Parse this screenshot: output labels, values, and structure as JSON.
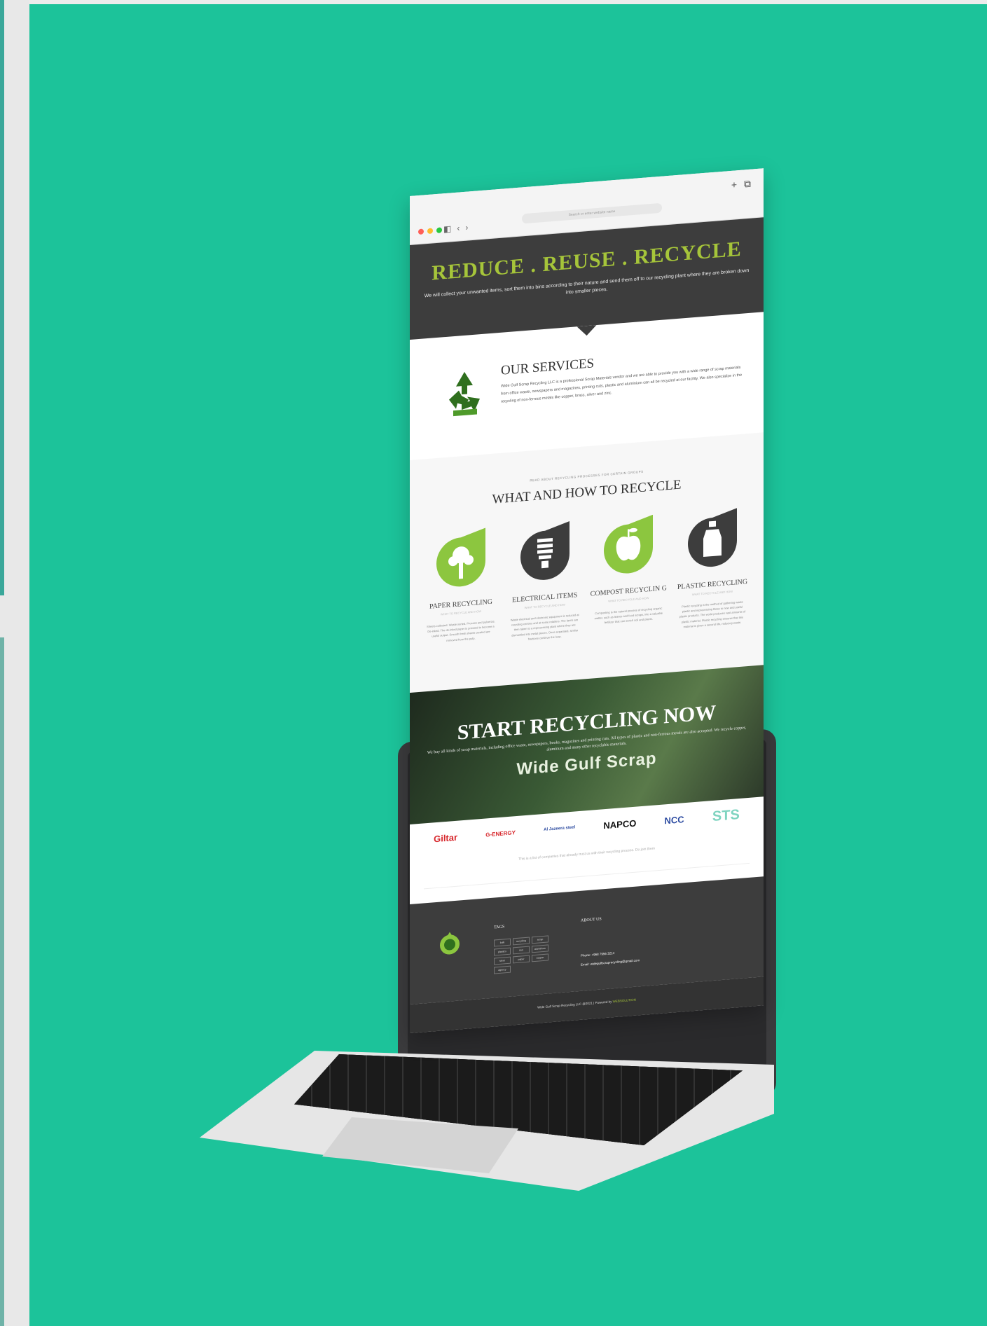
{
  "browser": {
    "url": "Search or enter website name",
    "nav_back": "‹",
    "nav_forward": "›",
    "sidebar_icon": "◧",
    "new_tab_icon": "+",
    "tabs_icon": "⧉"
  },
  "hero": {
    "title": "REDUCE . REUSE . RECYCLE",
    "text": "We will collect your unwanted items, sort them into bins according to their nature and send them off to our recycling plant where they are broken down into smaller pieces."
  },
  "services": {
    "title": "OUR SERVICES",
    "text": "Wide Gulf Scrap Recycling LLC is a professional Scrap Materials vendor and we are able to provide you with a wide range of scrap materials from office waste, newspapers and magazines, printing cuts, plastic and aluminium can all be recycled at our facility. We also specialize in the recycling of non-ferrous metals like copper, brass, silver and zinc."
  },
  "recycle": {
    "kicker": "READ ABOUT RECYCLING PROCESSES FOR CERTAIN GROUPS",
    "title": "WHAT AND HOW TO RECYCLE",
    "cards": [
      {
        "title": "PAPER RECYCLING",
        "sub": "WHAT TO RECYCLE AND HOW",
        "desc": "Sheets collected. Waste sorted. Process and pulverize. De-inked. The de-inked paper is pressed to become a useful output. Smooth fresh sheets created are removed from the pulp.",
        "icon": "tree-icon",
        "color": "#8cc63f"
      },
      {
        "title": "ELECTRICAL ITEMS",
        "sub": "WHAT TO RECYCLE AND HOW",
        "desc": "Waste electrical and electronic equipment is reduced at recycling centres and at some retailers. The items are then taken to a reprocessing plant where they are dismantled into metal pieces. Once separated, similar fractions continue the loop.",
        "icon": "bulb-icon",
        "color": "#3d3d3d"
      },
      {
        "title": "COMPOST RECYCLIN G",
        "sub": "WHAT TO RECYCLE AND HOW",
        "desc": "Composting is the natural process of recycling organic matter, such as leaves and food scraps, into a valuable fertilizer that can enrich soil and plants.",
        "icon": "apple-icon",
        "color": "#8cc63f"
      },
      {
        "title": "PLASTIC RECYCLING",
        "sub": "WHAT TO RECYCLE AND HOW",
        "desc": "Plastic recycling is the method of gathering waste plastic and reprocessing these to new and useful plastic products. The world produces vast amounts of plastic material. Plastic recycling ensures that this material is given a second life, reducing waste.",
        "icon": "bottle-icon",
        "color": "#3d3d3d"
      }
    ]
  },
  "start": {
    "title": "START RECYCLING NOW",
    "text": "We buy all kinds of scrap materials, including office waste, newspapers, books, magazines and printing cuts. All types of plastic and non-ferrous metals are also accepted. We recycle copper, aluminum and many other recyclable materials.",
    "brand": "Wide Gulf Scrap"
  },
  "partners": {
    "items": [
      {
        "name": "Giltar",
        "color": "#d7262b"
      },
      {
        "name": "G-ENERGY",
        "color": "#d7262b"
      },
      {
        "name": "Al Jazeera steel",
        "color": "#2b4aa0"
      },
      {
        "name": "NAPCO",
        "color": "#111111"
      },
      {
        "name": "NCC",
        "color": "#2b4aa0"
      },
      {
        "name": "STS",
        "color": "#7fd4c0"
      }
    ],
    "note": "This is a list of companies that already trust us with their recycling process. Do join them"
  },
  "footer": {
    "tags_title": "TAGS",
    "tags": [
      "bulk",
      "recycling",
      "scrap",
      "plastics",
      "iron",
      "aluminium",
      "silver",
      "paper",
      "copper",
      "agency"
    ],
    "about_title": "ABOUT US",
    "phone": "Phone: +968 7956 3214",
    "email": "Email: widegulfscraprecycling@gmail.com",
    "copyright": "Wide Gulf Scrap Recycling LLC @2021 | Powered by",
    "powered_by": "WEBSOLUTION"
  }
}
